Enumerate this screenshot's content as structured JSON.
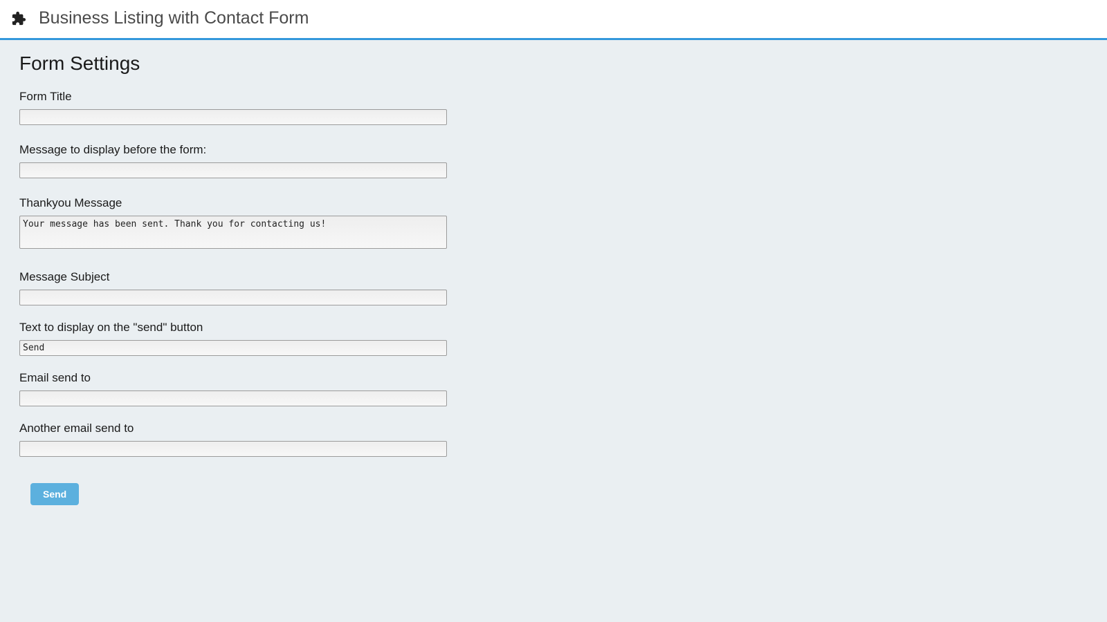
{
  "header": {
    "title": "Business Listing with Contact Form"
  },
  "section": {
    "title": "Form Settings"
  },
  "fields": {
    "form_title": {
      "label": "Form Title",
      "value": ""
    },
    "before_message": {
      "label": "Message to display before the form:",
      "value": ""
    },
    "thankyou": {
      "label": "Thankyou Message",
      "value": "Your message has been sent. Thank you for contacting us!"
    },
    "subject": {
      "label": "Message Subject",
      "value": ""
    },
    "send_button_text": {
      "label": "Text to display on the \"send\" button",
      "value": "Send"
    },
    "email_to": {
      "label": "Email send to",
      "value": ""
    },
    "another_email_to": {
      "label": "Another email send to",
      "value": ""
    }
  },
  "buttons": {
    "send": "Send"
  },
  "colors": {
    "accent": "#3498db",
    "button": "#5cb0de",
    "page_bg": "#eaeff2"
  }
}
